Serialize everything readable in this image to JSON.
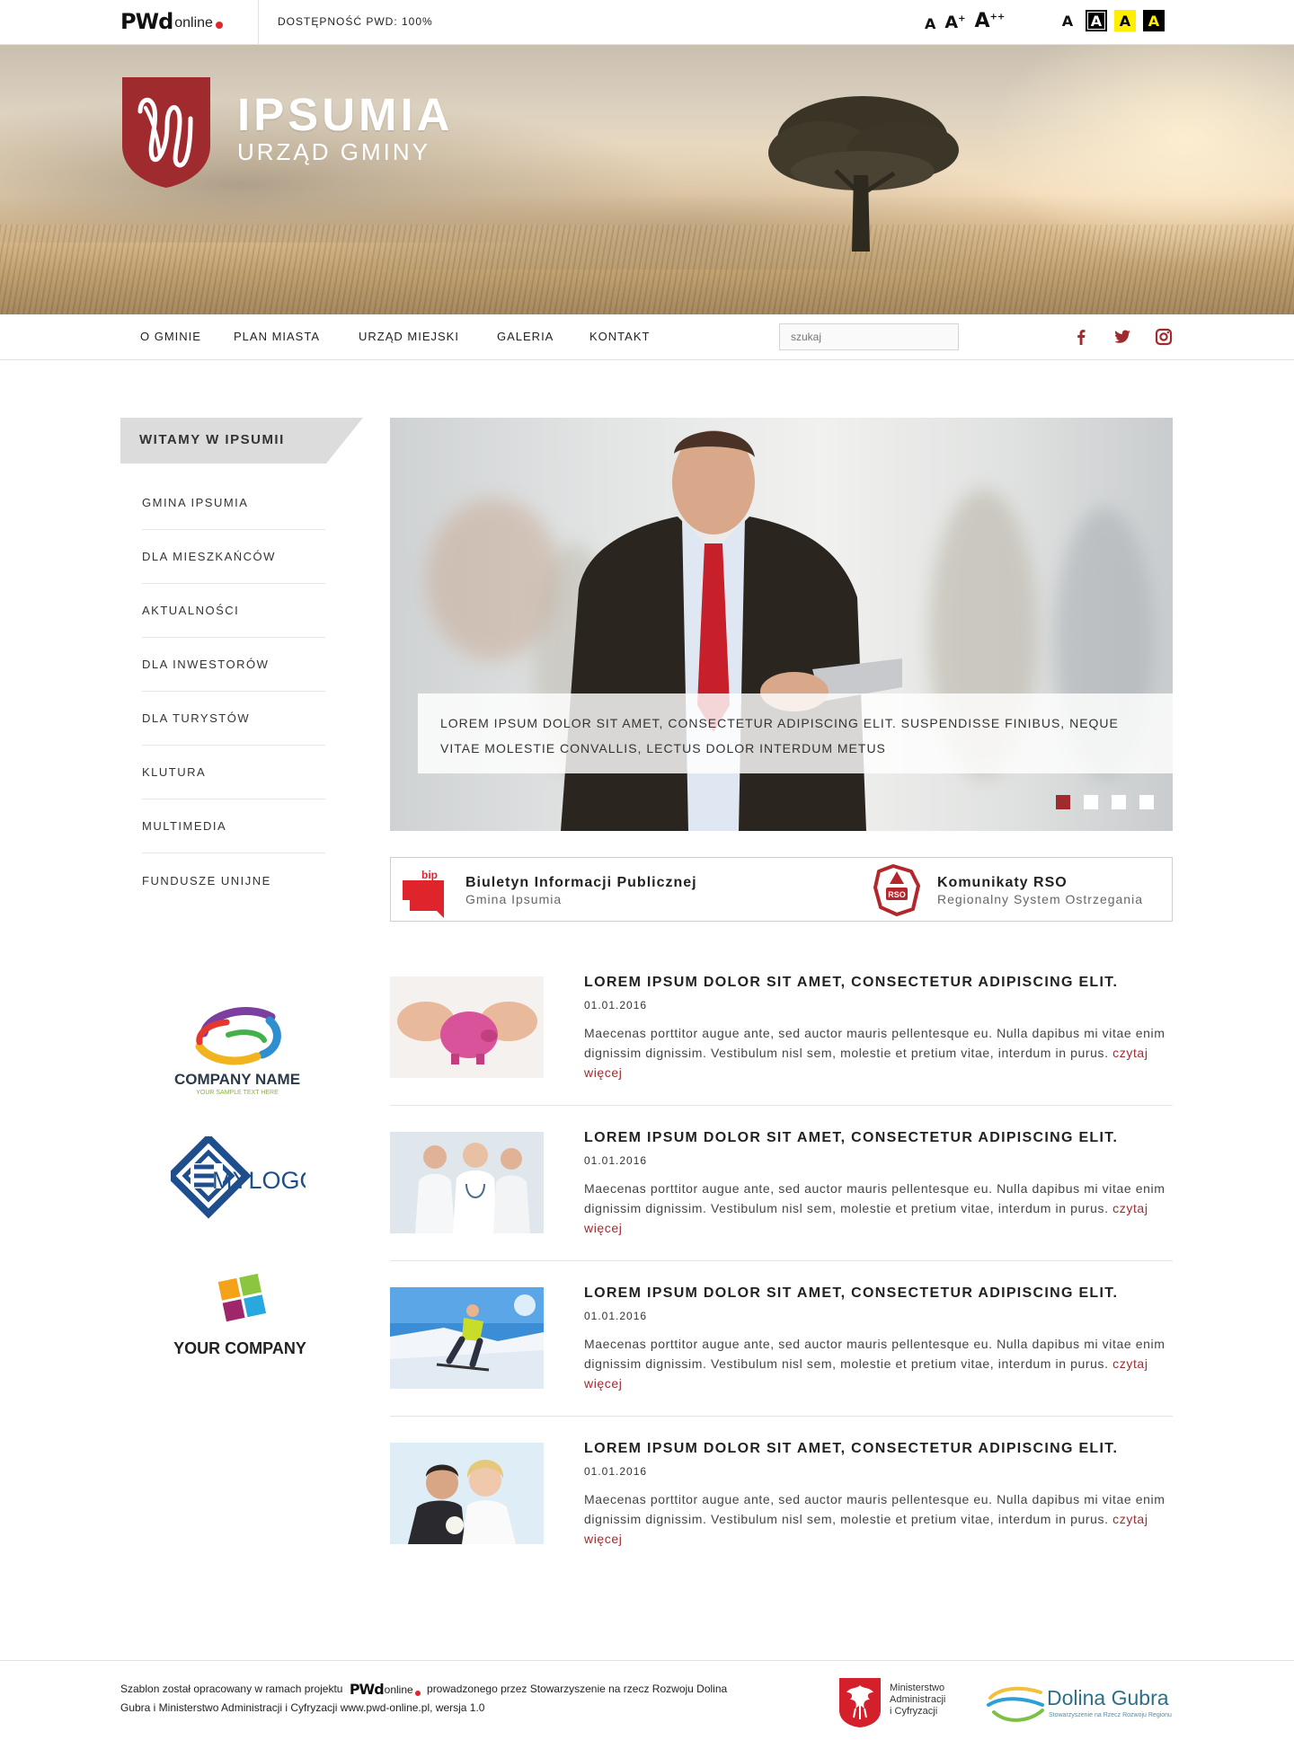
{
  "topbar": {
    "logo_brand": "PWd",
    "logo_suffix": "online",
    "accessibility_label": "DOSTĘPNOŚĆ PWD: 100%",
    "font_sizes": [
      "A",
      "A",
      "A"
    ],
    "font_size_marks": [
      "+",
      "++"
    ],
    "contrast_options": [
      "A",
      "A",
      "A",
      "A"
    ],
    "contrast_colors": [
      "#ffffff",
      "#000000",
      "#ffee00",
      "#000000"
    ]
  },
  "hero": {
    "name": "IPSUMIA",
    "subtitle": "URZĄD GMINY",
    "crest_color": "#a02b2f"
  },
  "nav": {
    "items": [
      "O GMINIE",
      "PLAN MIASTA",
      "URZĄD MIEJSKI",
      "GALERIA",
      "KONTAKT"
    ],
    "search_placeholder": "szukaj",
    "social": [
      "facebook-icon",
      "twitter-icon",
      "instagram-icon"
    ],
    "social_color": "#a02b2f"
  },
  "sidebar": {
    "header": "WITAMY W IPSUMII",
    "items": [
      "GMINA IPSUMIA",
      "DLA MIESZKAŃCÓW",
      "AKTUALNOŚCI",
      "DLA INWESTORÓW",
      "DLA TURYSTÓW",
      "KLUTURA",
      "MULTIMEDIA",
      "FUNDUSZE UNIJNE"
    ]
  },
  "partners": [
    {
      "name": "COMPANY NAME",
      "tagline": "YOUR SAMPLE TEXT HERE"
    },
    {
      "name": "MYLOGO"
    },
    {
      "name": "YOUR COMPANY"
    }
  ],
  "slider": {
    "caption": "LOREM IPSUM DOLOR SIT AMET, CONSECTETUR ADIPISCING ELIT. SUSPENDISSE FINIBUS, NEQUE VITAE MOLESTIE CONVALLIS, LECTUS DOLOR INTERDUM METUS",
    "dot_count": 4,
    "active_dot": 1,
    "accent": "#a02b2f"
  },
  "info": {
    "bip": {
      "icon_label": "bip",
      "title": "Biuletyn Informacji Publicznej",
      "subtitle": "Gmina Ipsumia"
    },
    "rso": {
      "icon_label": "RSO",
      "title": "Komunikaty RSO",
      "subtitle": "Regionalny System Ostrzegania"
    }
  },
  "news": [
    {
      "title": "LOREM IPSUM DOLOR SIT AMET, CONSECTETUR ADIPISCING ELIT.",
      "date": "01.01.2016",
      "excerpt": "Maecenas porttitor augue ante, sed auctor mauris pellentesque eu. Nulla dapibus mi vitae enim dignissim dignissim. Vestibulum nisl sem, molestie et pretium vitae, interdum in purus.",
      "more": "czytaj więcej"
    },
    {
      "title": "LOREM IPSUM DOLOR SIT AMET, CONSECTETUR ADIPISCING ELIT.",
      "date": "01.01.2016",
      "excerpt": "Maecenas porttitor augue ante, sed auctor mauris pellentesque eu. Nulla dapibus mi vitae enim dignissim dignissim. Vestibulum nisl sem, molestie et pretium vitae, interdum in purus.",
      "more": "czytaj więcej"
    },
    {
      "title": "LOREM IPSUM DOLOR SIT AMET, CONSECTETUR ADIPISCING ELIT.",
      "date": "01.01.2016",
      "excerpt": "Maecenas porttitor augue ante, sed auctor mauris pellentesque eu. Nulla dapibus mi vitae enim dignissim dignissim. Vestibulum nisl sem, molestie et pretium vitae, interdum in purus.",
      "more": "czytaj więcej"
    },
    {
      "title": "LOREM IPSUM DOLOR SIT AMET, CONSECTETUR ADIPISCING ELIT.",
      "date": "01.01.2016",
      "excerpt": "Maecenas porttitor augue ante, sed auctor mauris pellentesque eu. Nulla dapibus mi vitae enim dignissim dignissim. Vestibulum nisl sem, molestie et pretium vitae, interdum in purus.",
      "more": "czytaj więcej"
    }
  ],
  "footer": {
    "text_before": "Szablon został opracowany w ramach projektu",
    "text_after": "prowadzonego przez Stowarzyszenie na rzecz Rozwoju Dolina Gubra i Ministerstwo Administracji i Cyfryzacji www.pwd-online.pl, wersja 1.0",
    "ministry_lines": [
      "Ministerstwo",
      "Administracji",
      "i Cyfryzacji"
    ],
    "dolina_name": "Dolina Gubra",
    "dolina_sub": "Stowarzyszenie na Rzecz Rozwoju Regionu"
  }
}
